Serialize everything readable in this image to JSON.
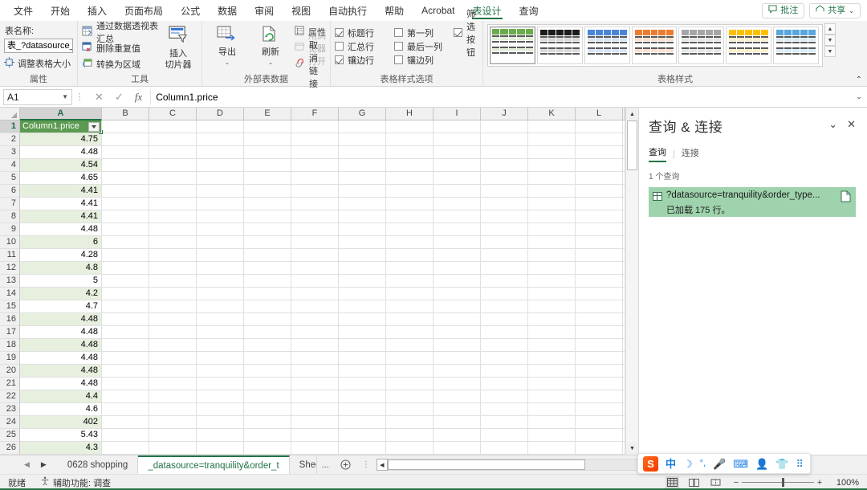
{
  "ribbon_tabs": [
    {
      "label": "文件",
      "active": false
    },
    {
      "label": "开始",
      "active": false
    },
    {
      "label": "插入",
      "active": false
    },
    {
      "label": "页面布局",
      "active": false
    },
    {
      "label": "公式",
      "active": false
    },
    {
      "label": "数据",
      "active": false
    },
    {
      "label": "审阅",
      "active": false
    },
    {
      "label": "视图",
      "active": false
    },
    {
      "label": "自动执行",
      "active": false
    },
    {
      "label": "帮助",
      "active": false
    },
    {
      "label": "Acrobat",
      "active": false
    },
    {
      "label": "表设计",
      "active": true
    },
    {
      "label": "查询",
      "active": false
    }
  ],
  "titlebar": {
    "comments_label": "批注",
    "share_label": "共享",
    "share_caret": "⌄"
  },
  "ribbon": {
    "groups": [
      {
        "name": "properties",
        "title": "属性",
        "table_name_label": "表名称:",
        "table_name_value": "表_?datasource_t",
        "resize_label": "调整表格大小"
      },
      {
        "name": "tools",
        "title": "工具",
        "items": [
          "通过数据透视表汇总",
          "删除重复值",
          "转换为区域"
        ],
        "big_button": "插入\n切片器",
        "big_button_line1": "插入",
        "big_button_line2": "切片器"
      },
      {
        "name": "external-table-data",
        "title": "外部表数据",
        "export_label": "导出",
        "refresh_label": "刷新",
        "properties_label": "属性",
        "open_browser_label": "用浏览器打开",
        "unlink_label": "取消链接"
      },
      {
        "name": "table-style-options",
        "title": "表格样式选项",
        "checkboxes": [
          {
            "label": "标题行",
            "checked": true
          },
          {
            "label": "第一列",
            "checked": false
          },
          {
            "label": "筛选按钮",
            "checked": true
          },
          {
            "label": "汇总行",
            "checked": false
          },
          {
            "label": "最后一列",
            "checked": false
          },
          {
            "label": "镶边行",
            "checked": true
          },
          {
            "label": "镶边列",
            "checked": false
          }
        ]
      },
      {
        "name": "table-styles",
        "title": "表格样式",
        "swatches": [
          {
            "head": "#6aab4a",
            "band": "#e3efd9",
            "selected": true
          },
          {
            "head": "#1c1c1c",
            "band": "#d9d9d9",
            "selected": false
          },
          {
            "head": "#4a86d8",
            "band": "#d9e5f7",
            "selected": false
          },
          {
            "head": "#ee7c30",
            "band": "#fbe0d0",
            "selected": false
          },
          {
            "head": "#a6a6a6",
            "band": "#e6e6e6",
            "selected": false
          },
          {
            "head": "#ffc000",
            "band": "#fdf0cd",
            "selected": false
          },
          {
            "head": "#5aa6dd",
            "band": "#daecf8",
            "selected": false
          }
        ]
      }
    ]
  },
  "formula_bar": {
    "name_box": "A1",
    "formula": "Column1.price",
    "cancel_icon": "✕",
    "confirm_icon": "✓",
    "fx_icon": "fx"
  },
  "grid": {
    "columns": [
      "A",
      "B",
      "C",
      "D",
      "E",
      "F",
      "G",
      "H",
      "I",
      "J",
      "K",
      "L"
    ],
    "selected_column": "A",
    "selected_row": 1,
    "header_cell": "Column1.price",
    "rows": [
      {
        "num": 1,
        "value": "Column1.price",
        "header": true
      },
      {
        "num": 2,
        "value": "4.75"
      },
      {
        "num": 3,
        "value": "4.48"
      },
      {
        "num": 4,
        "value": "4.54"
      },
      {
        "num": 5,
        "value": "4.65"
      },
      {
        "num": 6,
        "value": "4.41"
      },
      {
        "num": 7,
        "value": "4.41"
      },
      {
        "num": 8,
        "value": "4.41"
      },
      {
        "num": 9,
        "value": "4.48"
      },
      {
        "num": 10,
        "value": "6"
      },
      {
        "num": 11,
        "value": "4.28"
      },
      {
        "num": 12,
        "value": "4.8"
      },
      {
        "num": 13,
        "value": "5"
      },
      {
        "num": 14,
        "value": "4.2"
      },
      {
        "num": 15,
        "value": "4.7"
      },
      {
        "num": 16,
        "value": "4.48"
      },
      {
        "num": 17,
        "value": "4.48"
      },
      {
        "num": 18,
        "value": "4.48"
      },
      {
        "num": 19,
        "value": "4.48"
      },
      {
        "num": 20,
        "value": "4.48"
      },
      {
        "num": 21,
        "value": "4.48"
      },
      {
        "num": 22,
        "value": "4.4"
      },
      {
        "num": 23,
        "value": "4.6"
      },
      {
        "num": 24,
        "value": "402"
      },
      {
        "num": 25,
        "value": "5.43"
      },
      {
        "num": 26,
        "value": "4.3"
      }
    ]
  },
  "queries_pane": {
    "title": "查询 & 连接",
    "collapse_icon": "⌄",
    "close_icon": "✕",
    "tab_queries": "查询",
    "tab_connections": "连接",
    "count_label": "1 个查询",
    "query": {
      "name": "?datasource=tranquility&order_type...",
      "status": "已加载 175 行。"
    }
  },
  "sheet_tabs": {
    "prev_arrow": "◀",
    "next_arrow": "▶",
    "tabs": [
      {
        "label": "0628 shopping",
        "active": false
      },
      {
        "label": "_datasource=tranquility&order_t",
        "active": true
      },
      {
        "label": "Sheet",
        "active": false
      }
    ],
    "more_label": "...",
    "add_label": "+",
    "dots": "⋮"
  },
  "status_bar": {
    "ready": "就绪",
    "accessibility": "辅助功能: 调查",
    "zoom": "100%",
    "zoom_minus": "−",
    "zoom_plus": "+"
  },
  "ime_bar": {
    "logo": "S",
    "mode": "中",
    "items": [
      "中",
      "☽",
      "°,",
      "🎤",
      "⌨",
      "👤",
      "👕",
      "⠿"
    ]
  }
}
